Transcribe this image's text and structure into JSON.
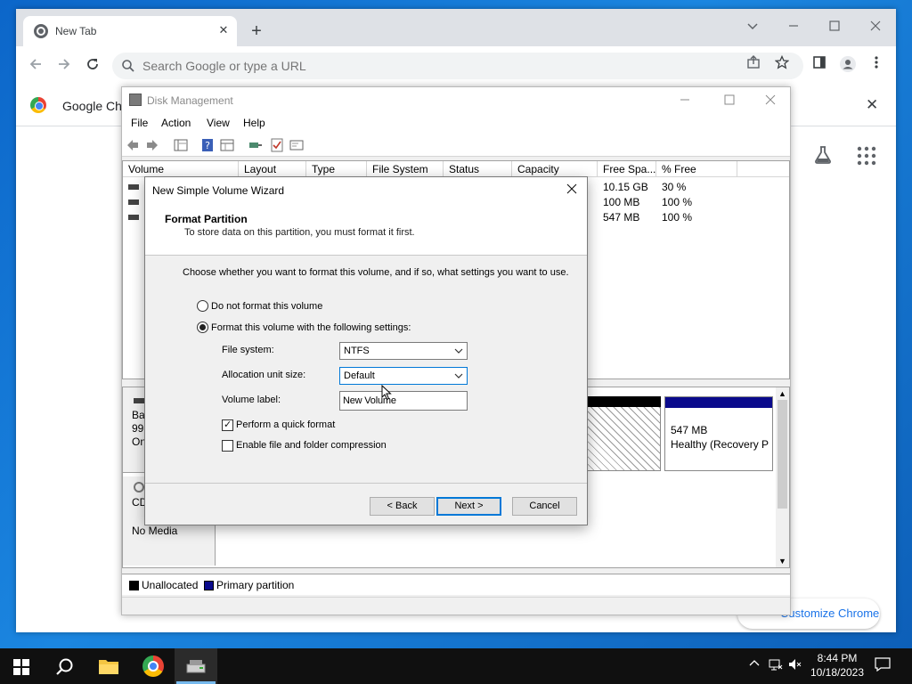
{
  "browser": {
    "tab_title": "New Tab",
    "tab_close": "✕",
    "new_tab": "+",
    "omnibox_placeholder": "Search Google or type a URL",
    "bookmark_bar_text": "Google Chr",
    "bar_close": "✕",
    "customize_label": "Customize Chrome"
  },
  "disk_management": {
    "title": "Disk Management",
    "menu": [
      "File",
      "Action",
      "View",
      "Help"
    ],
    "columns": [
      "Volume",
      "Layout",
      "Type",
      "File System",
      "Status",
      "Capacity",
      "Free Spa...",
      "% Free"
    ],
    "rows": [
      {
        "free": "10.15 GB",
        "pct": "30 %"
      },
      {
        "free": "100 MB",
        "pct": "100 %"
      },
      {
        "free": "547 MB",
        "pct": "100 %"
      }
    ],
    "disk0_label_lines": [
      "Ba",
      "99.",
      "On"
    ],
    "cd_label_lines": [
      "CD",
      "No Media"
    ],
    "recovery_size": "547 MB",
    "recovery_status": "Healthy (Recovery P",
    "legend": [
      "Unallocated",
      "Primary partition"
    ],
    "colors": {
      "unallocated": "#000000",
      "primary": "#0a0a8c"
    }
  },
  "wizard": {
    "title": "New Simple Volume Wizard",
    "heading": "Format Partition",
    "subheading": "To store data on this partition, you must format it first.",
    "intro": "Choose whether you want to format this volume, and if so, what settings you want to use.",
    "opt_no_format": "Do not format this volume",
    "opt_format": "Format this volume with the following settings:",
    "selected_option": "format",
    "file_system_label": "File system:",
    "file_system_value": "NTFS",
    "alloc_label": "Allocation unit size:",
    "alloc_value": "Default",
    "volume_label_label": "Volume label:",
    "volume_label_value": "New Volume",
    "quick_format_label": "Perform a quick format",
    "quick_format_checked": true,
    "compression_label": "Enable file and folder compression",
    "compression_checked": false,
    "back_label": "< Back",
    "next_label": "Next >",
    "cancel_label": "Cancel"
  },
  "taskbar": {
    "time": "8:44 PM",
    "date": "10/18/2023"
  }
}
